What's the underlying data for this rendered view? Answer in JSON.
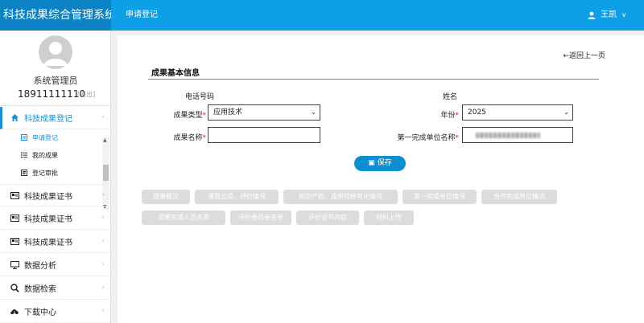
{
  "header": {
    "app_title": "科技成果综合管理系统",
    "breadcrumb": "申请登记",
    "user_name": "王凯",
    "user_menu_caret": "∨"
  },
  "sidebar": {
    "admin_name": "系统管理员",
    "admin_phone": "18911111110",
    "logout_label": "[退出]",
    "items": [
      {
        "label": "科技成果登记",
        "icon": "home-icon",
        "active": true
      },
      {
        "label": "科技成果证书",
        "icon": "certificate-icon"
      },
      {
        "label": "科技成果证书",
        "icon": "certificate-icon"
      },
      {
        "label": "科技成果证书",
        "icon": "certificate-icon"
      },
      {
        "label": "数据分析",
        "icon": "monitor-icon"
      },
      {
        "label": "数据检索",
        "icon": "search-icon"
      },
      {
        "label": "下载中心",
        "icon": "download-cloud-icon"
      }
    ],
    "sub_items": [
      {
        "label": "申请登记",
        "icon": "form-icon",
        "active": true
      },
      {
        "label": "我的成果",
        "icon": "list-icon"
      },
      {
        "label": "登记审批",
        "icon": "approval-icon"
      }
    ],
    "chevron": "›"
  },
  "main": {
    "back_link": "←返回上一页",
    "section_title": "成果基本信息",
    "form": {
      "phone_label": "电话号码",
      "name_label": "姓名",
      "type_label": "成果类型",
      "type_value": "应用技术",
      "year_label": "年份",
      "year_value": "2025",
      "achievement_name_label": "成果名称",
      "achievement_name_value": "",
      "first_unit_label": "第一完成单位名称",
      "required_mark": "*",
      "select_caret": "⌄"
    },
    "save_label": "保存",
    "tabs": [
      "成果概况",
      "课题立项、评价情况",
      "知识产权、成果转移转化情况",
      "第一完成单位情况",
      "合作完成单位情况",
      "成果完成人员名单",
      "评价委员会名单",
      "评价证书内容",
      "材料上传"
    ]
  },
  "colors": {
    "header_bg": "#0ea0e6",
    "brand_bg": "#0a82c4",
    "accent": "#1a8fd8",
    "save_button": "#0c8fd0",
    "required": "#e02020",
    "disabled_tab": "#dcdcdc"
  }
}
